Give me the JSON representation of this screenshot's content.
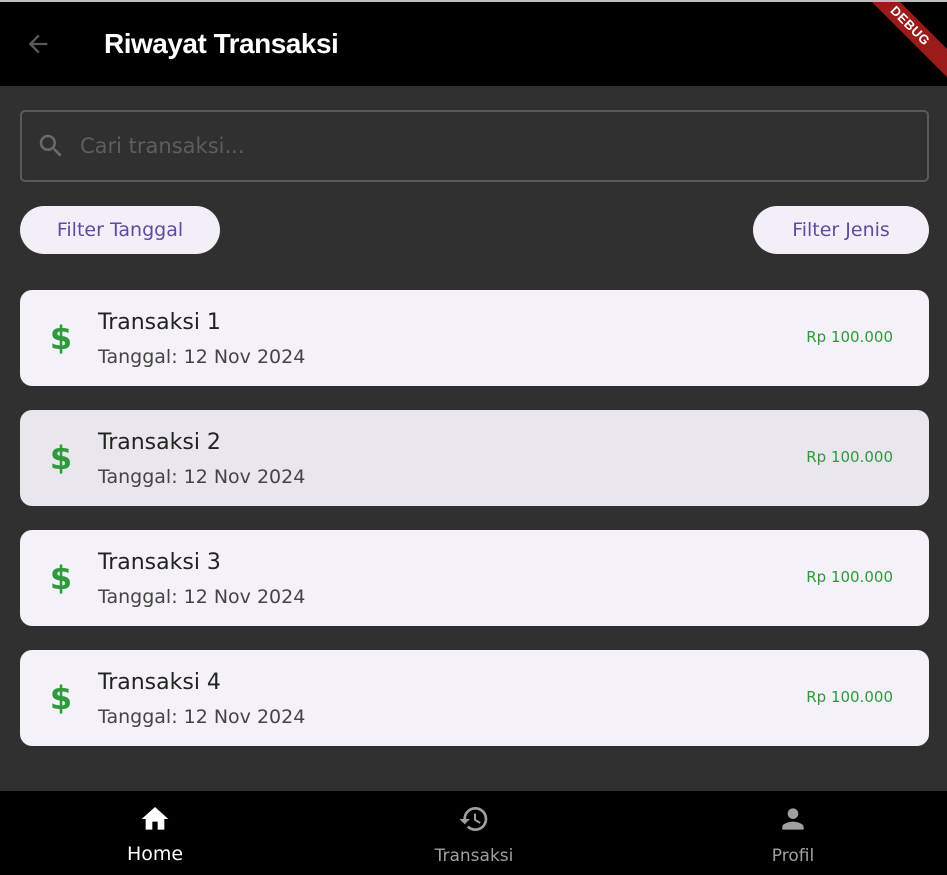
{
  "appbar": {
    "title": "Riwayat Transaksi",
    "debug_label": "DEBUG"
  },
  "search": {
    "placeholder": "Cari transaksi..."
  },
  "filters": {
    "date_label": "Filter Tanggal",
    "type_label": "Filter Jenis"
  },
  "transactions": [
    {
      "title": "Transaksi 1",
      "date": "Tanggal: 12 Nov 2024",
      "amount": "Rp 100.000",
      "icon": "dollar-icon"
    },
    {
      "title": "Transaksi 2",
      "date": "Tanggal: 12 Nov 2024",
      "amount": "Rp 100.000",
      "icon": "dollar-icon"
    },
    {
      "title": "Transaksi 3",
      "date": "Tanggal: 12 Nov 2024",
      "amount": "Rp 100.000",
      "icon": "dollar-icon"
    },
    {
      "title": "Transaksi 4",
      "date": "Tanggal: 12 Nov 2024",
      "amount": "Rp 100.000",
      "icon": "dollar-icon"
    }
  ],
  "bottom_nav": {
    "items": [
      {
        "label": "Home",
        "icon": "home-icon",
        "active": true
      },
      {
        "label": "Transaksi",
        "icon": "history-icon",
        "active": false
      },
      {
        "label": "Profil",
        "icon": "person-icon",
        "active": false
      }
    ]
  },
  "colors": {
    "accent_green": "#2e9a3c",
    "chip_text": "#5e4ba0",
    "card_bg": "#f4f1f8",
    "background": "#303030"
  }
}
